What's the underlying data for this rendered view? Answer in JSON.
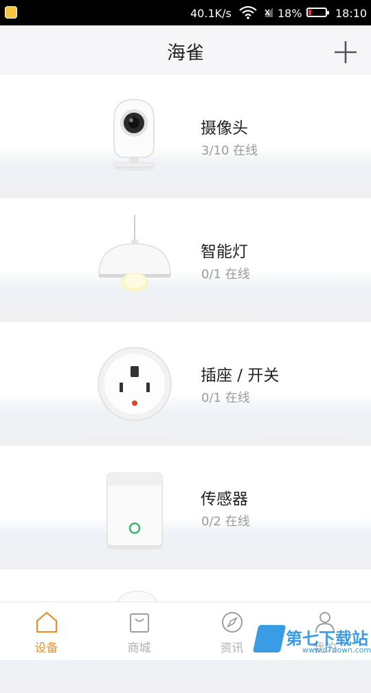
{
  "status_bar": {
    "speed": "40.1K/s",
    "battery": "18%",
    "time": "18:10"
  },
  "header": {
    "title": "海雀",
    "add_icon": "plus-icon"
  },
  "devices": [
    {
      "name": "摄像头",
      "status": "3/10 在线",
      "icon": "camera-icon"
    },
    {
      "name": "智能灯",
      "status": "0/1 在线",
      "icon": "lamp-icon"
    },
    {
      "name": "插座 / 开关",
      "status": "0/1 在线",
      "icon": "socket-icon"
    },
    {
      "name": "传感器",
      "status": "0/2 在线",
      "icon": "sensor-icon"
    }
  ],
  "nav": [
    {
      "label": "设备",
      "icon": "home-icon",
      "active": true
    },
    {
      "label": "商城",
      "icon": "shopping-bag-icon",
      "active": false
    },
    {
      "label": "资讯",
      "icon": "compass-icon",
      "active": false
    },
    {
      "label": "我的",
      "icon": "user-icon",
      "active": false
    }
  ],
  "watermark": {
    "text": "第七下载站",
    "url": "www.d7down.com"
  },
  "colors": {
    "accent": "#e8912c",
    "nav_inactive": "#b0b0b0",
    "status_text": "#9a9a9a"
  }
}
